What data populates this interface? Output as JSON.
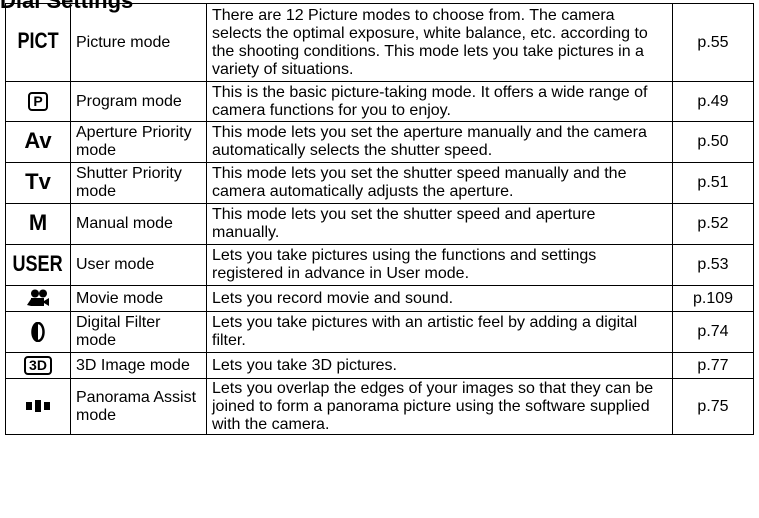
{
  "heading": "Dial Settings",
  "rows": [
    {
      "icon_text": "PICT",
      "icon": "picture-mode-icon",
      "name": "Picture mode",
      "desc": "There are 12 Picture modes to choose from. The camera selects the optimal exposure, white balance, etc. according to the shooting conditions. This mode lets you take pictures in a variety of situations.",
      "page": "p.55"
    },
    {
      "icon_text": "P",
      "icon": "program-mode-icon",
      "name": "Program mode",
      "desc": "This is the basic picture-taking mode. It offers a wide range of camera functions for you to enjoy.",
      "page": "p.49"
    },
    {
      "icon_text": "Av",
      "icon": "aperture-priority-icon",
      "name": "Aperture Priority mode",
      "desc": "This mode lets you set the aperture manually and the camera automatically selects the shutter speed.",
      "page": "p.50"
    },
    {
      "icon_text": "Tv",
      "icon": "shutter-priority-icon",
      "name": "Shutter Priority mode",
      "desc": "This mode lets you set the shutter speed manually and the camera automatically adjusts the aperture.",
      "page": "p.51"
    },
    {
      "icon_text": "M",
      "icon": "manual-mode-icon",
      "name": "Manual mode",
      "desc": "This mode lets you set the shutter speed and aperture manually.",
      "page": "p.52"
    },
    {
      "icon_text": "USER",
      "icon": "user-mode-icon",
      "name": "User mode",
      "desc": "Lets you take pictures using the functions and settings registered in advance in User mode.",
      "page": "p.53"
    },
    {
      "icon_text": "",
      "icon": "movie-mode-icon",
      "name": "Movie mode",
      "desc": "Lets you record movie and sound.",
      "page": "p.109"
    },
    {
      "icon_text": "",
      "icon": "digital-filter-icon",
      "name": "Digital Filter mode",
      "desc": "Lets you take pictures with an artistic feel by adding a digital filter.",
      "page": "p.74"
    },
    {
      "icon_text": "3D",
      "icon": "3d-image-mode-icon",
      "name": "3D Image mode",
      "desc": "Lets you take 3D pictures.",
      "page": "p.77"
    },
    {
      "icon_text": "",
      "icon": "panorama-assist-icon",
      "name": "Panorama Assist mode",
      "desc": "Lets you overlap the edges of your images so that they can be joined to form a panorama picture using the software supplied with the camera.",
      "page": "p.75"
    }
  ]
}
